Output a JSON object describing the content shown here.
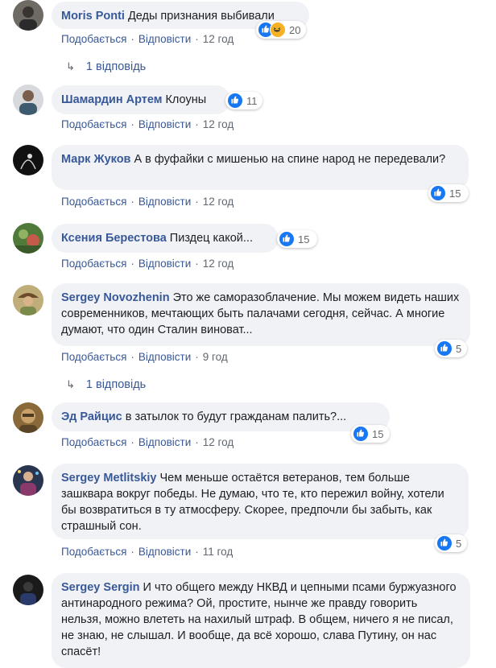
{
  "actions": {
    "like": "Подобається",
    "reply": "Відповісти",
    "sep": "·"
  },
  "comments": [
    {
      "author": "Moris Ponti",
      "text": "Деды признания выбивали",
      "time": "12 год",
      "reactions": {
        "types": [
          "like-icon",
          "haha-icon"
        ],
        "count": "20"
      },
      "replies": "1 відповідь"
    },
    {
      "author": "Шамардин Артем",
      "text": "Клоуны",
      "time": "12 год",
      "reactions": {
        "types": [
          "like-icon"
        ],
        "count": "11"
      }
    },
    {
      "author": "Марк Жуков",
      "text": "А в фуфайки с мишенью на спине народ не передевали?",
      "time": "12 год",
      "reactions": {
        "types": [
          "like-icon"
        ],
        "count": "15"
      }
    },
    {
      "author": "Ксения Берестова",
      "text": "Пиздец какой...",
      "time": "12 год",
      "reactions": {
        "types": [
          "like-icon"
        ],
        "count": "15"
      }
    },
    {
      "author": "Sergey Novozhenin",
      "text": "Это же саморазоблачение. Мы можем видеть наших современников, мечтающих быть палачами сегодня, сейчас. А многие думают, что один Сталин виноват...",
      "time": "9 год",
      "reactions": {
        "types": [
          "like-icon"
        ],
        "count": "5"
      },
      "replies": "1 відповідь"
    },
    {
      "author": "Эд Райцис",
      "text": "в затылок то будут гражданам палить?...",
      "time": "12 год",
      "reactions": {
        "types": [
          "like-icon"
        ],
        "count": "15"
      }
    },
    {
      "author": "Sergey Metlitskiy",
      "text": "Чем меньше остаётся ветеранов, тем больше зашквара вокруг победы. Не думаю, что те, кто пережил войну, хотели бы возвратиться в ту атмосферу. Скорее, предпочли бы забыть, как страшный сон.",
      "time": "11 год",
      "reactions": {
        "types": [
          "like-icon"
        ],
        "count": "5"
      }
    },
    {
      "author": "Sergey Sergin",
      "text": "И что общего между НКВД и цепными псами буржуазного антинародного режима? Ой, простите, нынче же правду говорить нельзя, можно влететь на нахилый штраф. В общем, ничего я не писал, не знаю, не слышал. И вообще, да всё хорошо, слава Путину, он нас спасёт!"
    }
  ]
}
